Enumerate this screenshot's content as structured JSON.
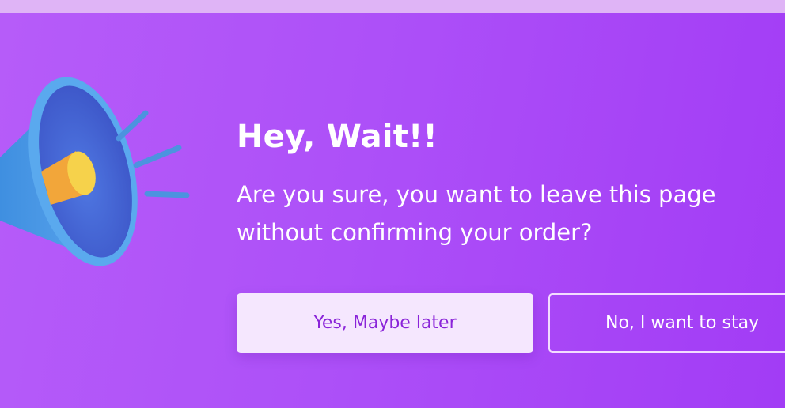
{
  "dialog": {
    "title": "Hey, Wait!!",
    "message_line1": "Are you sure, you want to leave this page",
    "message_line2": "without confirming your order?",
    "confirm_label": "Yes, Maybe later",
    "stay_label": "No, I want to stay",
    "icon": "megaphone-icon"
  },
  "colors": {
    "background_start": "#b65cf9",
    "background_end": "#a23cf5",
    "primary_button_bg": "#f5e7fe",
    "primary_button_text": "#8a24d9",
    "text": "#ffffff"
  }
}
